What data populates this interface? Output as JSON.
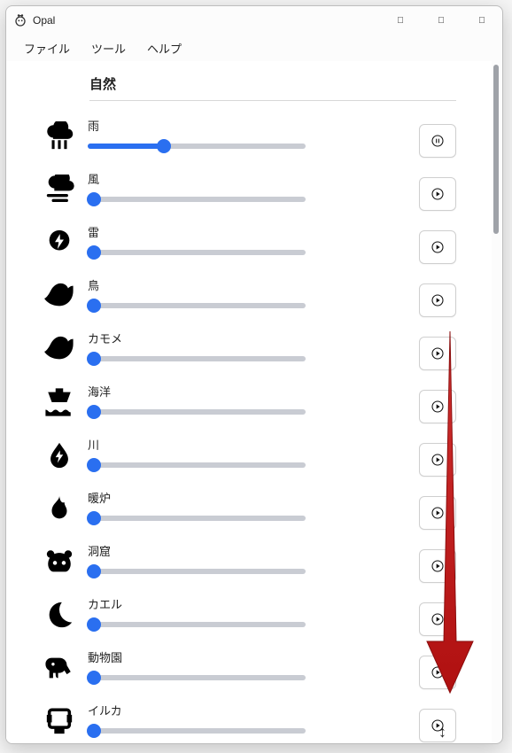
{
  "window": {
    "app_name": "Opal"
  },
  "menubar": {
    "items": [
      "ファイル",
      "ツール",
      "ヘルプ"
    ]
  },
  "section": {
    "title": "自然"
  },
  "sounds": [
    {
      "label": "雨",
      "icon": "rain-cloud-icon",
      "value": 35,
      "state": "playing"
    },
    {
      "label": "風",
      "icon": "wind-cloud-icon",
      "value": 3,
      "state": "stopped"
    },
    {
      "label": "雷",
      "icon": "thunder-cloud-icon",
      "value": 3,
      "state": "stopped"
    },
    {
      "label": "鳥",
      "icon": "bird-icon",
      "value": 3,
      "state": "stopped"
    },
    {
      "label": "カモメ",
      "icon": "seagull-icon",
      "value": 3,
      "state": "stopped"
    },
    {
      "label": "海洋",
      "icon": "ship-wave-icon",
      "value": 3,
      "state": "stopped"
    },
    {
      "label": "川",
      "icon": "water-drop-icon",
      "value": 3,
      "state": "stopped"
    },
    {
      "label": "暖炉",
      "icon": "flame-icon",
      "value": 3,
      "state": "stopped"
    },
    {
      "label": "洞窟",
      "icon": "cave-bear-icon",
      "value": 3,
      "state": "stopped"
    },
    {
      "label": "カエル",
      "icon": "moon-icon",
      "value": 3,
      "state": "stopped"
    },
    {
      "label": "動物園",
      "icon": "elephant-icon",
      "value": 3,
      "state": "stopped"
    },
    {
      "label": "イルカ",
      "icon": "dolphin-box-icon",
      "value": 3,
      "state": "stopped"
    }
  ],
  "colors": {
    "accent": "#2a6ff0",
    "track": "#c9ccd3",
    "arrow": "#c11a1a"
  },
  "scrollbar": {
    "thumb_top_pct": 0,
    "thumb_height_pct": 25
  }
}
